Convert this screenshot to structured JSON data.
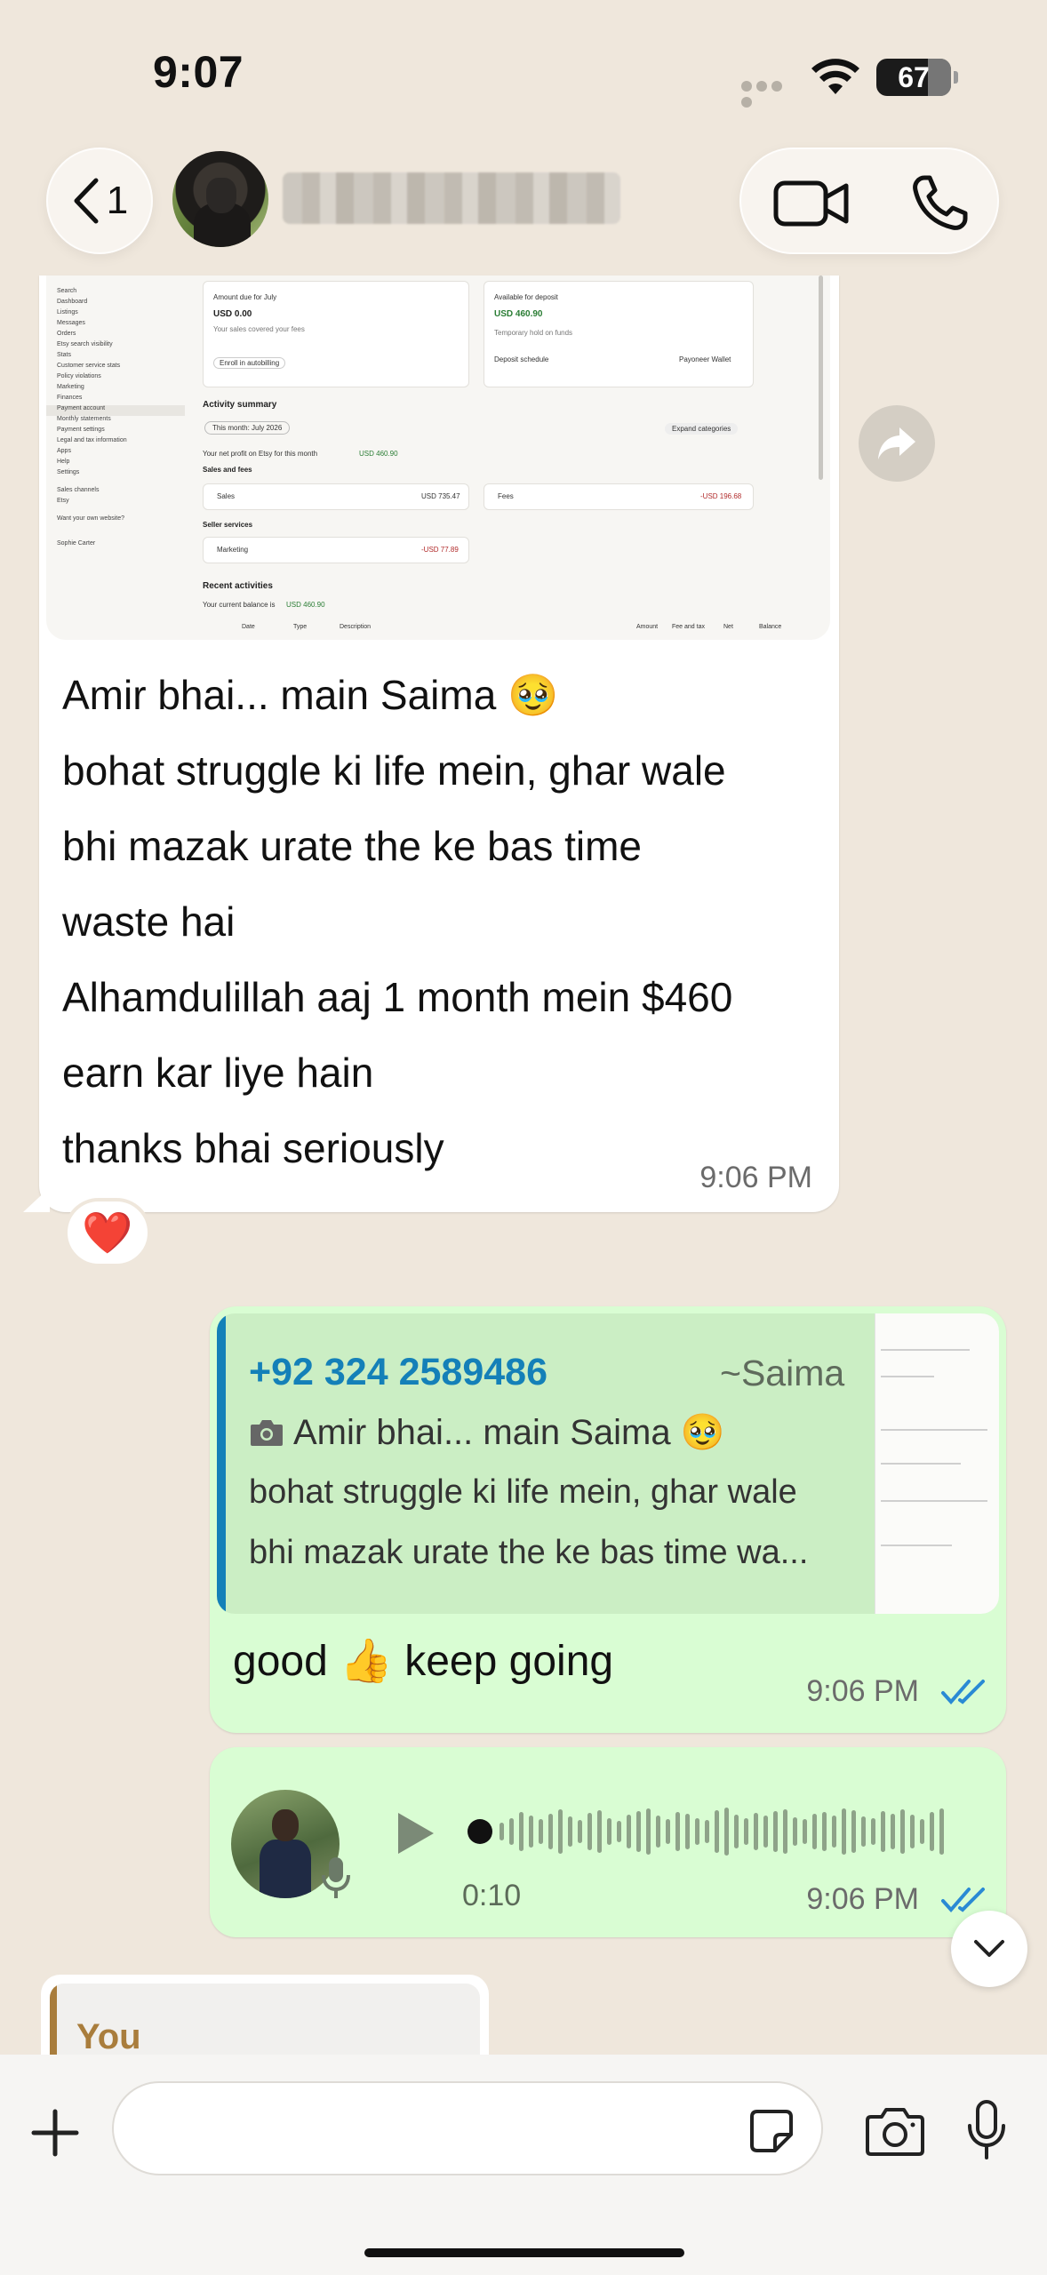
{
  "status_bar": {
    "time": "9:07",
    "battery": "67"
  },
  "header": {
    "back_count": "1",
    "call_icons": [
      "video-call-icon",
      "voice-call-icon"
    ]
  },
  "incoming_message": {
    "screenshot": {
      "sidebar_items": [
        "Search",
        "Dashboard",
        "Listings",
        "Messages",
        "Orders",
        "Etsy search visibility",
        "Stats",
        "Customer service stats",
        "Policy violations",
        "Marketing",
        "Finances",
        "Payment account",
        "Monthly statements",
        "Payment settings",
        "Legal and tax information",
        "Apps",
        "Help",
        "Settings",
        "Sales channels",
        "Etsy",
        "Want your own website?",
        "Sophie Carter"
      ],
      "amount_due_label": "Amount due for July",
      "amount_due_value": "USD 0.00",
      "amount_due_note": "Your sales covered your fees",
      "autobilling_label": "Enroll in autobilling",
      "available_label": "Available for deposit",
      "available_value": "USD 460.90",
      "temp_hold": "Temporary hold on funds",
      "deposit_schedule": "Deposit schedule",
      "payoneer": "Payoneer Wallet",
      "activity_title": "Activity summary",
      "this_month": "This month: July 2026",
      "expand": "Expand categories",
      "net_profit_prefix": "Your net profit on Etsy for this month",
      "net_profit_value": "USD 460.90",
      "sales_fees_title": "Sales and fees",
      "sales_label": "Sales",
      "sales_value": "USD 735.47",
      "fees_label": "Fees",
      "fees_value": "-USD 196.68",
      "seller_services_title": "Seller services",
      "marketing_label": "Marketing",
      "marketing_value": "-USD 77.89",
      "recent_title": "Recent activities",
      "current_balance_prefix": "Your current balance is",
      "current_balance_value": "USD 460.90",
      "columns": [
        "Date",
        "Type",
        "Description",
        "Amount",
        "Fee and tax",
        "Net",
        "Balance"
      ]
    },
    "lines": [
      "Amir bhai... main Saima 🥹",
      "bohat struggle ki life mein, ghar wale",
      "bhi mazak urate the ke bas time",
      "waste hai",
      "Alhamdulillah aaj 1 month mein $460",
      "earn kar liye hain",
      "thanks bhai seriously"
    ],
    "time": "9:06 PM",
    "reaction": "❤️"
  },
  "outgoing_reply": {
    "quote": {
      "sender": "+92 324 2589486",
      "alias": "~Saima",
      "line1": "Amir bhai... main Saima 🥹",
      "line2": "bohat struggle ki life mein, ghar wale",
      "line3": "bhi mazak urate the ke bas time wa..."
    },
    "text": "good 👍 keep going",
    "time": "9:06 PM"
  },
  "outgoing_voice": {
    "duration": "0:10",
    "time": "9:06 PM"
  },
  "reply_preview": {
    "sender": "You"
  },
  "colors": {
    "incoming_bubble": "#ffffff",
    "outgoing_bubble": "#d9fdd3",
    "quote_accent": "#1480b8",
    "read_ticks": "#2a8ad4",
    "wallpaper": "#efe7dc"
  }
}
